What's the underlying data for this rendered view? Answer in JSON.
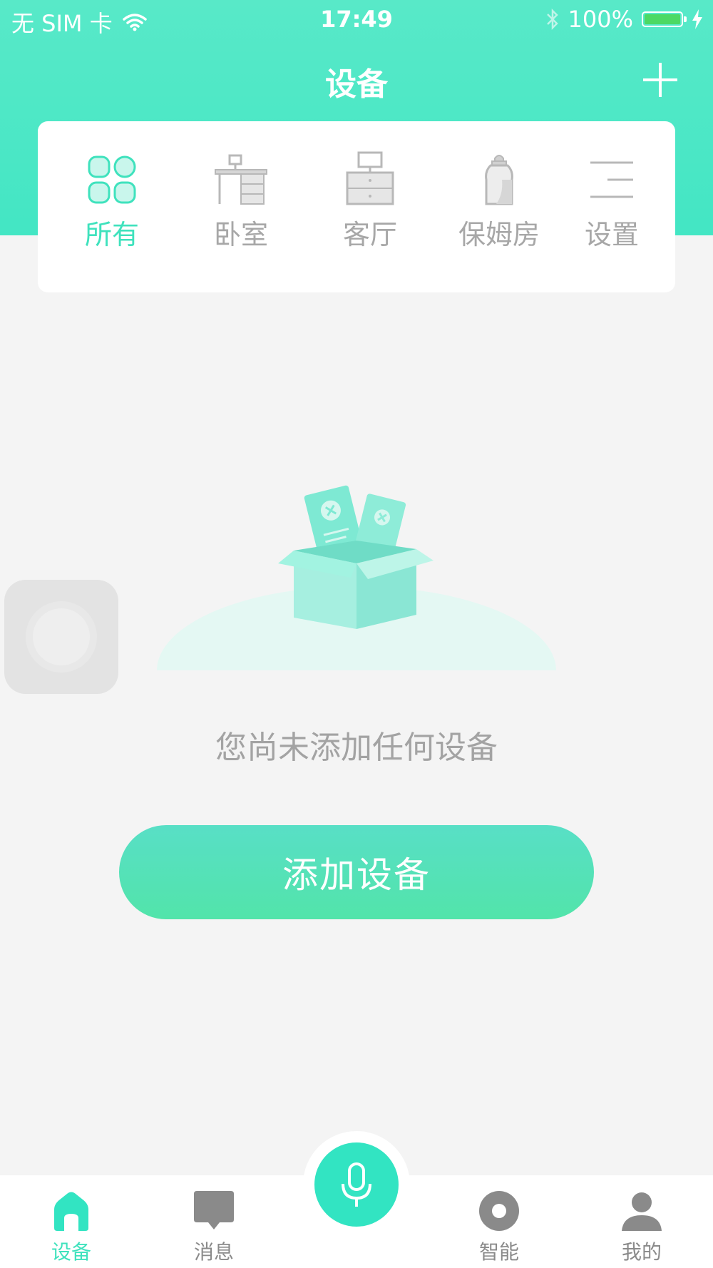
{
  "status_bar": {
    "carrier": "无 SIM 卡",
    "time": "17:49",
    "battery": "100%"
  },
  "nav": {
    "title": "设备"
  },
  "rooms": [
    {
      "label": "所有",
      "icon": "grid-icon",
      "active": true
    },
    {
      "label": "卧室",
      "icon": "desk-icon",
      "active": false
    },
    {
      "label": "客厅",
      "icon": "cabinet-icon",
      "active": false
    },
    {
      "label": "保姆房",
      "icon": "baby-bottle-icon",
      "active": false
    },
    {
      "label": "设置",
      "icon": "menu-lines-icon",
      "active": false
    }
  ],
  "empty_state": {
    "message": "您尚未添加任何设备",
    "button": "添加设备"
  },
  "tabbar": [
    {
      "label": "设备",
      "icon": "home-icon",
      "active": true
    },
    {
      "label": "消息",
      "icon": "message-icon",
      "active": false
    },
    {
      "label": "智能",
      "icon": "smart-icon",
      "active": false
    },
    {
      "label": "我的",
      "icon": "profile-icon",
      "active": false
    }
  ],
  "colors": {
    "accent": "#3fe2bd",
    "header": "#4fe8c6",
    "inactive": "#a7a7a7",
    "background": "#f4f4f4"
  }
}
